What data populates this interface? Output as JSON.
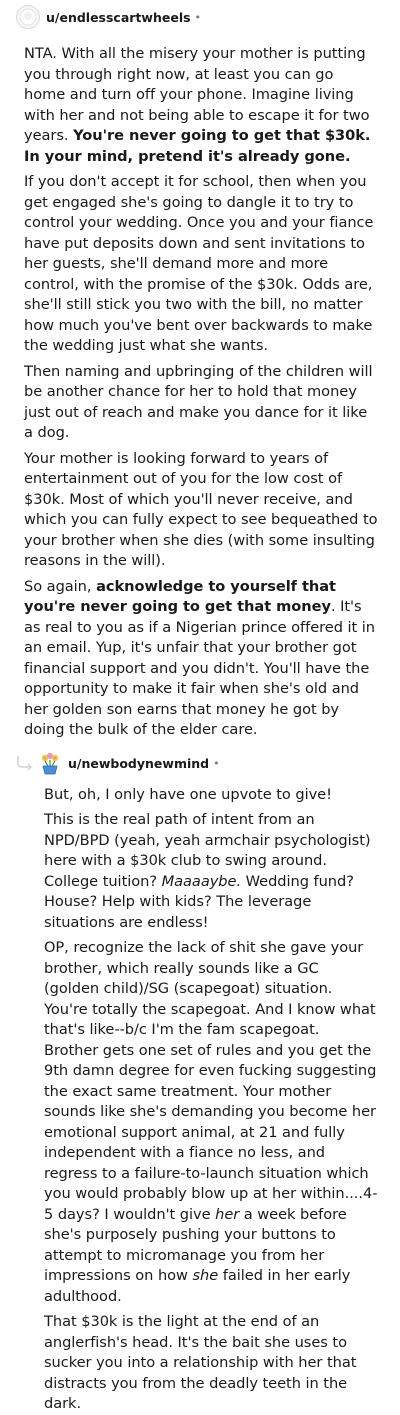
{
  "comment1": {
    "username": "u/endlesscartwheels",
    "separator": "•",
    "paragraphs": [
      [
        {
          "t": "NTA. With all the misery your mother is putting you through right now, at least you can go home and turn off your phone. Imagine living with her and not being able to escape it for two years. "
        },
        {
          "t": "You're never going to get that $30k. In your mind, pretend it's already gone.",
          "b": true
        }
      ],
      [
        {
          "t": "If you don't accept it for school, then when you get engaged she's going to dangle it to try to control your wedding. Once you and your fiance have put deposits down and sent invitations to her guests, she'll demand more and more control, with the promise of the $30k. Odds are, she'll still stick you two with the bill, no matter how much you've bent over backwards to make the wedding just what she wants."
        }
      ],
      [
        {
          "t": "Then naming and upbringing of the children will be another chance for her to hold that money just out of reach and make you dance for it like a dog."
        }
      ],
      [
        {
          "t": "Your mother is looking forward to years of entertainment out of you for the low cost of $30k. Most of which you'll never receive, and which you can fully expect to see bequeathed to your brother when she dies (with some insulting reasons in the will)."
        }
      ],
      [
        {
          "t": "So again, "
        },
        {
          "t": "acknowledge to yourself that you're never going to get that money",
          "b": true
        },
        {
          "t": ". It's as real to you as if a Nigerian prince offered it in an email. Yup, it's unfair that your brother got financial support and you didn't. You'll have the opportunity to make it fair when she's old and her golden son earns that money he got by doing the bulk of the elder care."
        }
      ]
    ]
  },
  "comment2": {
    "username": "u/newbodynewmind",
    "separator": "•",
    "paragraphs": [
      [
        {
          "t": "But, oh, I only have one upvote to give!"
        }
      ],
      [
        {
          "t": "This is the real path of intent from an NPD/BPD (yeah, yeah armchair psychologist) here with a $30k club to swing around. College tuition? "
        },
        {
          "t": "Maaaaybe.",
          "i": true
        },
        {
          "t": " Wedding fund? House? Help with kids? The leverage situations are endless!"
        }
      ],
      [
        {
          "t": "OP, recognize the lack of shit she gave your brother, which really sounds like a GC (golden child)/SG (scapegoat) situation. You're totally the scapegoat. And I know what that's like--b/c I'm the fam scapegoat. Brother gets one set of rules and you get the 9th damn degree for even fucking suggesting the exact same treatment. Your mother sounds like she's demanding you become her emotional support animal, at 21 and fully independent with a fiance no less, and regress to a failure-to-launch situation which you would probably blow up at her within....4-5 days? I wouldn't give "
        },
        {
          "t": "her",
          "i": true
        },
        {
          "t": " a week before she's purposely pushing your buttons to attempt to micromanage you from her impressions on how "
        },
        {
          "t": "she",
          "i": true
        },
        {
          "t": " failed in her early adulthood."
        }
      ],
      [
        {
          "t": "That $30k is the light at the end of an anglerfish's head. It's the bait she uses to sucker you into a relationship with her that distracts you from the deadly teeth in the dark."
        }
      ]
    ]
  },
  "icons": {
    "avatar1": "default-avatar-icon",
    "reply": "reply-thread-arrow-icon",
    "avatar2": "flower-pot-avatar-icon"
  },
  "colors": {
    "text": "#1a1a1b",
    "meta": "#7c7c7c",
    "thread_line": "#cfd3d6"
  }
}
